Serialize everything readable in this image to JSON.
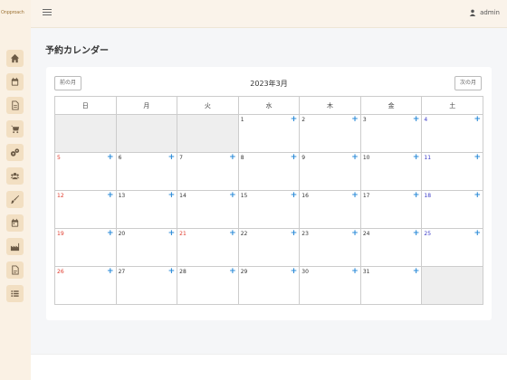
{
  "app": {
    "logo_text": "Onpproach"
  },
  "sidebar": {
    "items": [
      {
        "icon": "home-icon"
      },
      {
        "icon": "calendar-icon"
      },
      {
        "icon": "document-icon"
      },
      {
        "icon": "cart-icon"
      },
      {
        "icon": "settings-group-icon"
      },
      {
        "icon": "users-icon"
      },
      {
        "icon": "brush-icon"
      },
      {
        "icon": "calendar-alt-icon"
      },
      {
        "icon": "factory-icon"
      },
      {
        "icon": "report-icon"
      },
      {
        "icon": "list-icon"
      }
    ]
  },
  "header": {
    "username": "admin"
  },
  "page": {
    "title": "予約カレンダー"
  },
  "calendar": {
    "prev_label": "前の月",
    "next_label": "次の月",
    "month_title": "2023年3月",
    "weekdays": [
      "日",
      "月",
      "火",
      "水",
      "木",
      "金",
      "土"
    ],
    "add_symbol": "+",
    "holidays": [
      21
    ],
    "first_weekday": 3,
    "days_in_month": 31
  },
  "colors": {
    "sunday": "#e0392b",
    "saturday": "#3a3ac8",
    "add": "#2b8bd8",
    "sidebar_bg": "#faf1e4"
  }
}
